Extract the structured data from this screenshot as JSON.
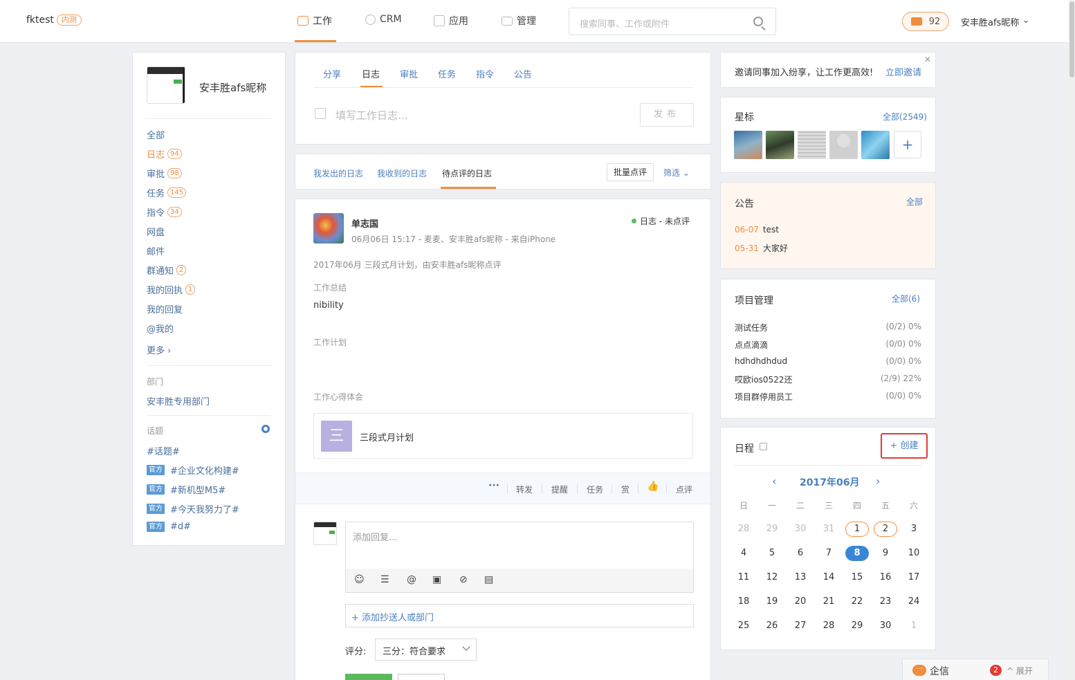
{
  "header": {
    "brand": "fktest",
    "brand_badge": "内测",
    "nav": [
      {
        "label": "工作",
        "icon": "work-icon"
      },
      {
        "label": "CRM",
        "icon": "crm-icon"
      },
      {
        "label": "应用",
        "icon": "apps-icon"
      },
      {
        "label": "管理",
        "icon": "admin-icon"
      }
    ],
    "search_placeholder": "搜索同事、工作或附件",
    "mail_count": "92",
    "user_name": "安丰胜afs昵称"
  },
  "sidebar": {
    "profile_name": "安丰胜afs昵称",
    "items": [
      {
        "label": "全部",
        "count": ""
      },
      {
        "label": "日志",
        "count": "94"
      },
      {
        "label": "审批",
        "count": "98"
      },
      {
        "label": "任务",
        "count": "145"
      },
      {
        "label": "指令",
        "count": "34"
      },
      {
        "label": "网盘",
        "count": ""
      },
      {
        "label": "邮件",
        "count": ""
      },
      {
        "label": "群通知",
        "count": "2"
      },
      {
        "label": "我的回执",
        "count": "1"
      },
      {
        "label": "我的回复",
        "count": ""
      },
      {
        "label": "@我的",
        "count": ""
      },
      {
        "label": "更多 ›",
        "count": ""
      }
    ],
    "dept_title": "部门",
    "dept_name": "安丰胜专用部门",
    "topics_title": "话题",
    "topics": [
      {
        "tag": "",
        "label": "#话题#"
      },
      {
        "tag": "官方",
        "label": "#企业文化构建#"
      },
      {
        "tag": "官方",
        "label": "#新机型M5#"
      },
      {
        "tag": "官方",
        "label": "#今天我努力了#"
      },
      {
        "tag": "官方",
        "label": "#d#"
      }
    ]
  },
  "compose": {
    "tabs": [
      "分享",
      "日志",
      "审批",
      "任务",
      "指令",
      "公告"
    ],
    "placeholder": "填写工作日志...",
    "publish_label": "发布"
  },
  "filter": {
    "tabs": [
      "我发出的日志",
      "我收到的日志",
      "待点评的日志"
    ],
    "batch_label": "批量点评",
    "filter_label": "筛选 ⌄"
  },
  "post": {
    "author": "单志国",
    "meta": "06月06日 15:17 - 麦麦、安丰胜afs昵称 - 来自iPhone",
    "status": "日志 - 未点评",
    "summary": "2017年06月 三段式月计划，由安丰胜afs昵称点评",
    "work_summary_label": "工作总结",
    "work_summary_value": "nibility",
    "work_plan_label": "工作计划",
    "insight_label": "工作心得体会",
    "attachment_icon": "三",
    "attachment_name": "三段式月计划",
    "actions": [
      "转发",
      "提醒",
      "任务",
      "赏",
      "点评"
    ],
    "reply_placeholder": "添加回复...",
    "cc_label": "+ 添加抄送人或部门",
    "score_label": "评分:",
    "score_value": "三分：符合要求"
  },
  "right": {
    "invite_text": "邀请同事加入纷享，让工作更高效!",
    "invite_link": "立即邀请",
    "starred_title": "星标",
    "starred_all": "全部(2549)",
    "notice_title": "公告",
    "notice_all": "全部",
    "notices": [
      {
        "date": "06-07",
        "text": "test"
      },
      {
        "date": "05-31",
        "text": "大家好"
      }
    ],
    "projects_title": "项目管理",
    "projects_all": "全部(6)",
    "projects": [
      {
        "name": "测试任务",
        "value": "(0/2) 0%"
      },
      {
        "name": "点点滴滴",
        "value": "(0/0) 0%"
      },
      {
        "name": "hdhdhdhdud",
        "value": "(0/0) 0%"
      },
      {
        "name": "哎欧ios0522还",
        "value": "(2/9) 22%"
      },
      {
        "name": "项目群停用员工",
        "value": "(0/0) 0%"
      }
    ],
    "schedule_title": "日程",
    "create_label": "+ 创建",
    "calendar_month": "2017年06月",
    "weekdays": [
      "日",
      "一",
      "二",
      "三",
      "四",
      "五",
      "六"
    ],
    "weeks": [
      [
        "28",
        "29",
        "30",
        "31",
        "1",
        "2",
        "3"
      ],
      [
        "4",
        "5",
        "6",
        "7",
        "8",
        "9",
        "10"
      ],
      [
        "11",
        "12",
        "13",
        "14",
        "15",
        "16",
        "17"
      ],
      [
        "18",
        "19",
        "20",
        "21",
        "22",
        "23",
        "24"
      ],
      [
        "25",
        "26",
        "27",
        "28",
        "29",
        "30",
        "1"
      ]
    ],
    "today": "8"
  },
  "qixin": {
    "title": "企信",
    "badge": "2",
    "expand_label": "^ 展开"
  }
}
